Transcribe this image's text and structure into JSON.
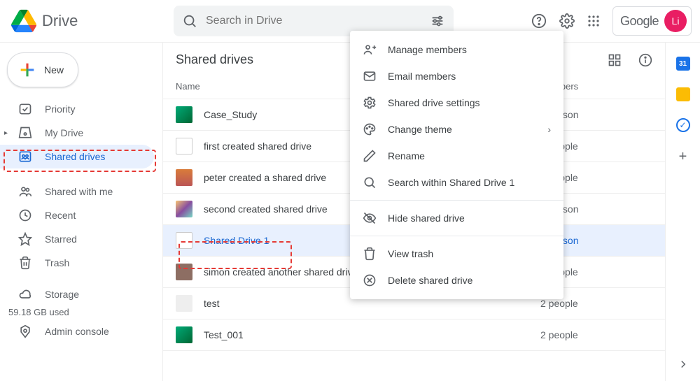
{
  "app": {
    "name": "Drive",
    "google_label": "Google",
    "avatar_initials": "Li"
  },
  "search": {
    "placeholder": "Search in Drive"
  },
  "sidebar": {
    "new_label": "New",
    "items": [
      {
        "label": "Priority"
      },
      {
        "label": "My Drive"
      },
      {
        "label": "Shared drives"
      },
      {
        "label": "Shared with me"
      },
      {
        "label": "Recent"
      },
      {
        "label": "Starred"
      },
      {
        "label": "Trash"
      }
    ],
    "storage_label": "Storage",
    "storage_used": "59.18 GB used",
    "admin_label": "Admin console"
  },
  "main": {
    "title": "Shared drives",
    "columns": {
      "name": "Name",
      "members": "Members"
    },
    "rows": [
      {
        "name": "Case_Study",
        "members": "1 person"
      },
      {
        "name": "first created shared drive",
        "members": "2 people"
      },
      {
        "name": "peter created a shared drive",
        "members": "2 people"
      },
      {
        "name": "second created shared drive",
        "members": "1 person"
      },
      {
        "name": "Shared Drive 1",
        "members": "1 person"
      },
      {
        "name": "simon created another shared drive",
        "members": "2 people"
      },
      {
        "name": "test",
        "members": "2 people"
      },
      {
        "name": "Test_001",
        "members": "2 people"
      }
    ]
  },
  "menu": {
    "items": [
      {
        "label": "Manage members"
      },
      {
        "label": "Email members"
      },
      {
        "label": "Shared drive settings"
      },
      {
        "label": "Change theme"
      },
      {
        "label": "Rename"
      },
      {
        "label": "Search within Shared Drive 1"
      },
      {
        "label": "Hide shared drive"
      },
      {
        "label": "View trash"
      },
      {
        "label": "Delete shared drive"
      }
    ]
  },
  "rside": {
    "cal_day": "31"
  }
}
